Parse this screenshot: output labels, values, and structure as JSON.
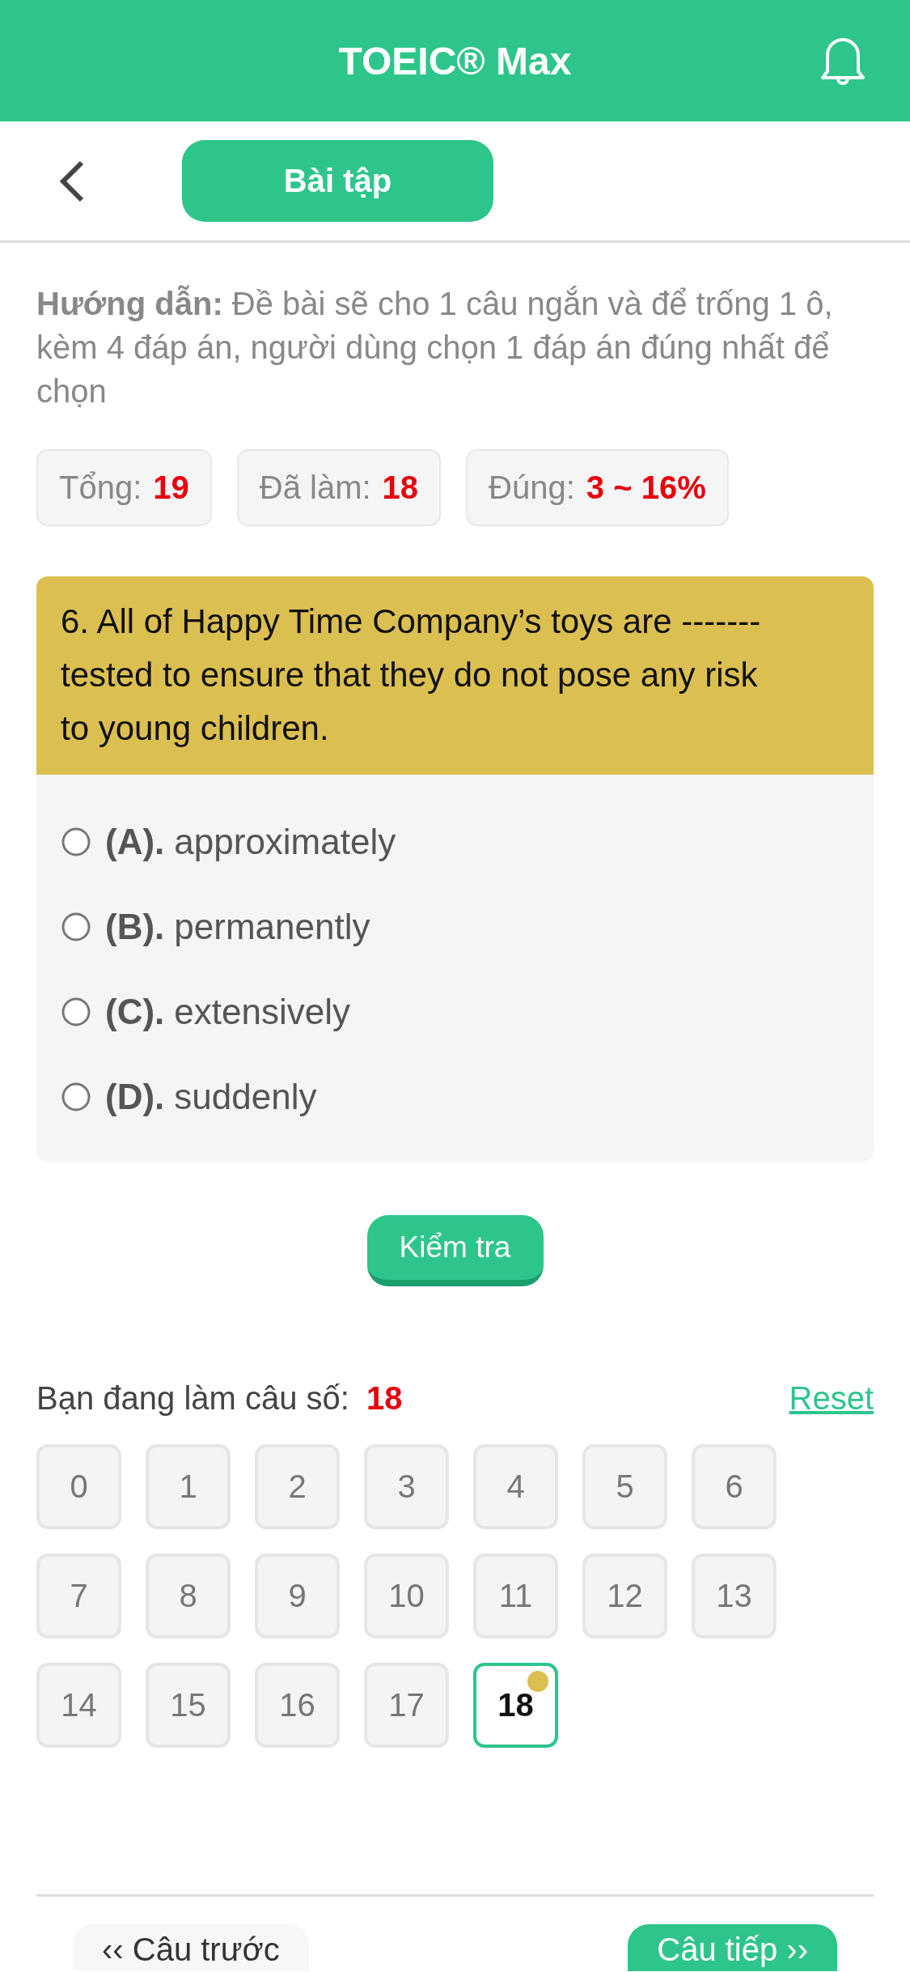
{
  "app_bar": {
    "title": "TOEIC® Max"
  },
  "section_button": "Bài tập",
  "instructions": "**Hướng dẫn:** Đề bài sẽ cho 1 câu ngắn và để trống 1 ô, kèm 4 đáp án, người dùng chọn 1 đáp án đúng nhất để chọn",
  "stats": [
    {
      "label": "Tổng:",
      "value": "19"
    },
    {
      "label": "Đã làm:",
      "value": "18"
    },
    {
      "label": "Đúng:",
      "value": "3 ~ 16%"
    }
  ],
  "question": {
    "text": "6. All of Happy Time Company’s toys are ------- tested to ensure that they do not pose any risk to young children.",
    "options": [
      {
        "letter": "(A).",
        "text": "approximately",
        "selected": false
      },
      {
        "letter": "(B).",
        "text": "permanently",
        "selected": false
      },
      {
        "letter": "(C).",
        "text": "extensively",
        "selected": false
      },
      {
        "letter": "(D).",
        "text": "suddenly",
        "selected": false
      }
    ]
  },
  "check_button": "Kiểm tra",
  "progress": {
    "label": "Bạn đang làm câu số:",
    "value": "18",
    "reset": "Reset"
  },
  "question_grid": [
    {
      "label": "0",
      "selected": false
    },
    {
      "label": "1",
      "selected": false
    },
    {
      "label": "2",
      "selected": false
    },
    {
      "label": "3",
      "selected": false
    },
    {
      "label": "4",
      "selected": false
    },
    {
      "label": "5",
      "selected": false
    },
    {
      "label": "6",
      "selected": false
    },
    {
      "label": "7",
      "selected": false
    },
    {
      "label": "8",
      "selected": false
    },
    {
      "label": "9",
      "selected": false
    },
    {
      "label": "10",
      "selected": false
    },
    {
      "label": "11",
      "selected": false
    },
    {
      "label": "12",
      "selected": false
    },
    {
      "label": "13",
      "selected": false
    },
    {
      "label": "14",
      "selected": false
    },
    {
      "label": "15",
      "selected": false
    },
    {
      "label": "16",
      "selected": false
    },
    {
      "label": "17",
      "selected": false
    },
    {
      "label": "18",
      "selected": true
    }
  ],
  "nav": {
    "previous": "‹‹ Câu trước",
    "next": "Câu tiếp ››"
  }
}
